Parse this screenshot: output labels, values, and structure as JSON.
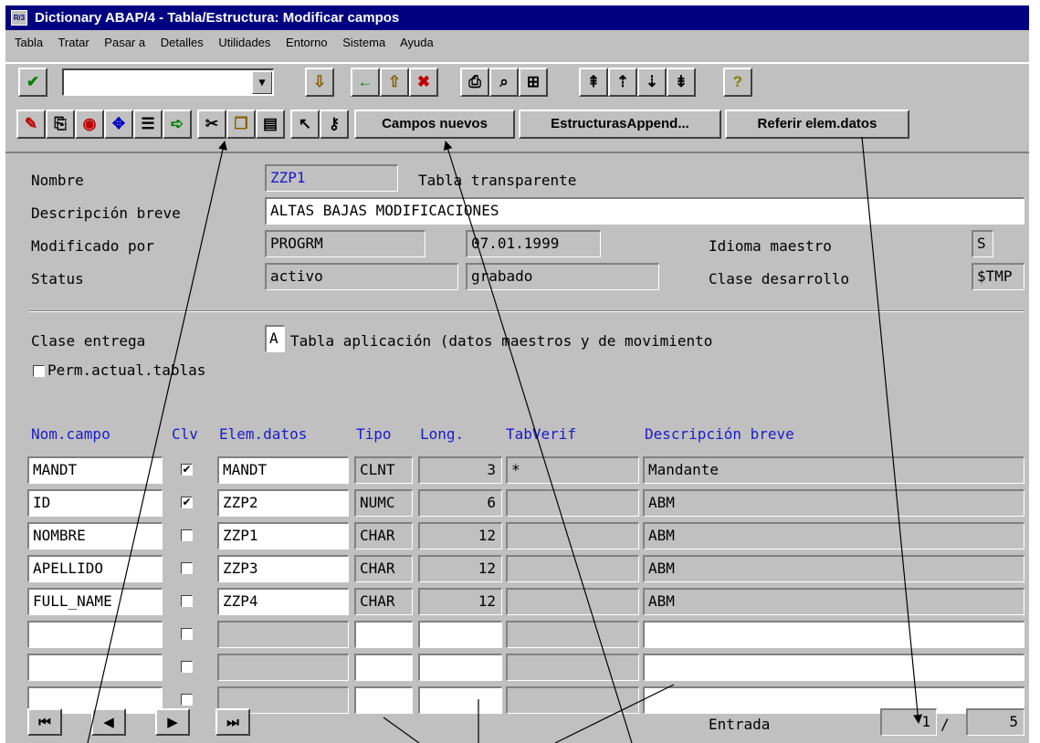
{
  "window": {
    "title": "Dictionary ABAP/4 - Tabla/Estructura: Modificar campos",
    "icon_text": "R/3"
  },
  "menu": [
    "Tabla",
    "Tratar",
    "Pasar a",
    "Detalles",
    "Utilidades",
    "Entorno",
    "Sistema",
    "Ayuda"
  ],
  "toolbar": {
    "command_value": "",
    "icons1": [
      "check-icon",
      "save-icon",
      "back-icon",
      "exit-icon",
      "cancel-icon",
      "print-icon",
      "find-icon",
      "find-next-icon",
      "first-page-icon",
      "previous-page-icon",
      "next-page-icon",
      "last-page-icon",
      "help-icon"
    ],
    "icons2": [
      "display-change-icon",
      "other-object-icon",
      "activate-icon",
      "where-used-icon",
      "technical-settings-icon",
      "insert-row-icon",
      "cut-icon",
      "copy-icon",
      "paste-icon",
      "select-icon",
      "foreign-key-icon"
    ],
    "btn_campos_nuevos": "Campos nuevos",
    "btn_estructuras_append": "EstructurasAppend...",
    "btn_referir": "Referir elem.datos"
  },
  "header": {
    "nombre_label": "Nombre",
    "nombre_value": "ZZP1",
    "tipo_tabla": "Tabla transparente",
    "descripcion_label": "Descripción breve",
    "descripcion_value": "ALTAS BAJAS MODIFICACIONES",
    "modificado_label": "Modificado por",
    "modificado_por": "PROGRM",
    "fecha": "07.01.1999",
    "idioma_label": "Idioma maestro",
    "idioma_value": "S",
    "status_label": "Status",
    "status_value": "activo",
    "status2_value": "grabado",
    "clase_desarrollo_label": "Clase desarrollo",
    "clase_desarrollo_value": "$TMP",
    "clase_entrega_label": "Clase entrega",
    "clase_entrega_value": "A",
    "clase_entrega_text": "Tabla aplicación (datos maestros y de movimiento",
    "perm_label": "Perm.actual.tablas"
  },
  "table": {
    "columns": [
      "Nom.campo",
      "Clv",
      "Elem.datos",
      "Tipo",
      "Long.",
      "TabVerif",
      "Descripción breve"
    ],
    "rows": [
      {
        "campo": "MANDT",
        "clave": true,
        "elem": "MANDT",
        "tipo": "CLNT",
        "long": "3",
        "tabverif": "*",
        "desc": "Mandante"
      },
      {
        "campo": "ID",
        "clave": true,
        "elem": "ZZP2",
        "tipo": "NUMC",
        "long": "6",
        "tabverif": "",
        "desc": "ABM"
      },
      {
        "campo": "NOMBRE",
        "clave": false,
        "elem": "ZZP1",
        "tipo": "CHAR",
        "long": "12",
        "tabverif": "",
        "desc": "ABM"
      },
      {
        "campo": "APELLIDO",
        "clave": false,
        "elem": "ZZP3",
        "tipo": "CHAR",
        "long": "12",
        "tabverif": "",
        "desc": "ABM"
      },
      {
        "campo": "FULL_NAME",
        "clave": false,
        "elem": "ZZP4",
        "tipo": "CHAR",
        "long": "12",
        "tabverif": "",
        "desc": "ABM"
      },
      {
        "campo": "",
        "clave": false,
        "elem": "",
        "tipo": "",
        "long": "",
        "tabverif": "",
        "desc": "",
        "empty": true
      },
      {
        "campo": "",
        "clave": false,
        "elem": "",
        "tipo": "",
        "long": "",
        "tabverif": "",
        "desc": "",
        "empty": true
      },
      {
        "campo": "",
        "clave": false,
        "elem": "",
        "tipo": "",
        "long": "",
        "tabverif": "",
        "desc": "",
        "empty": true
      }
    ]
  },
  "pager": {
    "entrada_label": "Entrada",
    "current": "1",
    "separator": "/",
    "total": "5"
  }
}
